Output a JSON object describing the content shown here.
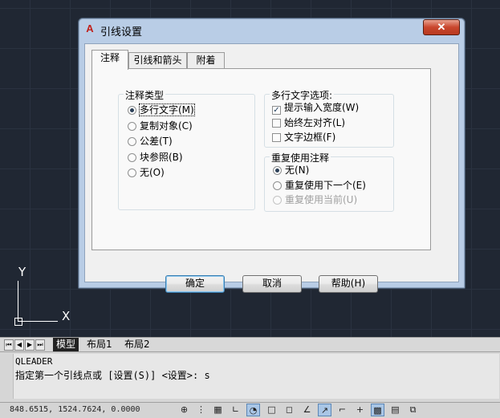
{
  "dialog": {
    "title": "引线设置",
    "close_label": "✕",
    "tabs": [
      "注释",
      "引线和箭头",
      "附着"
    ],
    "annotation_type": {
      "title": "注释类型",
      "options": [
        {
          "label": "多行文字(M)",
          "selected": true
        },
        {
          "label": "复制对象(C)",
          "selected": false
        },
        {
          "label": "公差(T)",
          "selected": false
        },
        {
          "label": "块参照(B)",
          "selected": false
        },
        {
          "label": "无(O)",
          "selected": false
        }
      ]
    },
    "mtext_options": {
      "title": "多行文字选项:",
      "options": [
        {
          "label": "提示输入宽度(W)",
          "checked": true
        },
        {
          "label": "始终左对齐(L)",
          "checked": false
        },
        {
          "label": "文字边框(F)",
          "checked": false
        }
      ]
    },
    "reuse": {
      "title": "重复使用注释",
      "options": [
        {
          "label": "无(N)",
          "selected": true,
          "disabled": false
        },
        {
          "label": "重复使用下一个(E)",
          "selected": false,
          "disabled": false
        },
        {
          "label": "重复使用当前(U)",
          "selected": false,
          "disabled": true
        }
      ]
    },
    "buttons": {
      "ok": "确定",
      "cancel": "取消",
      "help": "帮助(H)"
    }
  },
  "ucs": {
    "x": "X",
    "y": "Y"
  },
  "layout_tabs": [
    "模型",
    "布局1",
    "布局2"
  ],
  "command": {
    "history": "QLEADER",
    "prompt": "指定第一个引线点或 [设置(S)] <设置>: s"
  },
  "status": {
    "coords": "848.6515, 1524.7624, 0.0000"
  }
}
